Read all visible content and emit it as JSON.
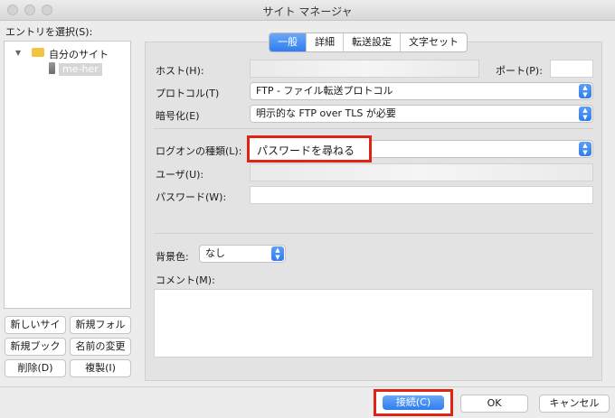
{
  "window": {
    "title": "サイト マネージャ"
  },
  "left": {
    "heading": "エントリを選択(S):",
    "tree": {
      "folder_label": "自分のサイト",
      "site_label": "me-her"
    },
    "buttons": {
      "new_site": "新しいサイ",
      "new_folder": "新規フォル",
      "new_bookmark": "新規ブック",
      "rename": "名前の変更",
      "delete": "削除(D)",
      "duplicate": "複製(I)"
    }
  },
  "tabs": [
    {
      "label": "一般"
    },
    {
      "label": "詳細"
    },
    {
      "label": "転送設定"
    },
    {
      "label": "文字セット"
    }
  ],
  "form": {
    "host_label": "ホスト(H):",
    "port_label": "ポート(P):",
    "protocol_label": "プロトコル(T)",
    "protocol_value": "FTP - ファイル転送プロトコル",
    "encryption_label": "暗号化(E)",
    "encryption_value": "明示的な FTP over TLS が必要",
    "logon_label": "ログオンの種類(L):",
    "logon_value": "パスワードを尋ねる",
    "user_label": "ユーザ(U):",
    "password_label": "パスワード(W):",
    "bgcolor_label": "背景色:",
    "bgcolor_value": "なし",
    "comment_label": "コメント(M):"
  },
  "footer": {
    "connect": "接続(C)",
    "ok": "OK",
    "cancel": "キャンセル"
  },
  "colors": {
    "accent": "#2f7df0",
    "highlight": "#e02414"
  }
}
